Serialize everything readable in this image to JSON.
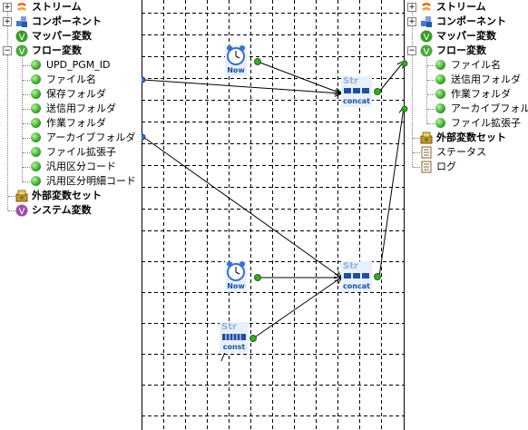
{
  "left_tree": {
    "items": [
      {
        "label": "ストリーム",
        "icon": "stream-icon",
        "bold": true
      },
      {
        "label": "コンポーネント",
        "icon": "component-icon",
        "bold": true
      },
      {
        "label": "マッパー変数",
        "icon": "mapper-variable-icon",
        "bold": true
      },
      {
        "label": "フロー変数",
        "icon": "flow-variable-icon",
        "bold": true
      },
      {
        "label": "UPD_PGM_ID",
        "icon": "variable-icon",
        "bold": false
      },
      {
        "label": "ファイル名",
        "icon": "variable-icon",
        "bold": false
      },
      {
        "label": "保存フォルダ",
        "icon": "variable-icon",
        "bold": false
      },
      {
        "label": "送信用フォルダ",
        "icon": "variable-icon",
        "bold": false
      },
      {
        "label": "作業フォルダ",
        "icon": "variable-icon",
        "bold": false
      },
      {
        "label": "アーカイブフォルダ",
        "icon": "variable-icon",
        "bold": false
      },
      {
        "label": "ファイル拡張子",
        "icon": "variable-icon",
        "bold": false
      },
      {
        "label": "汎用区分コード",
        "icon": "variable-icon",
        "bold": false
      },
      {
        "label": "汎用区分明細コード",
        "icon": "variable-icon",
        "bold": false
      },
      {
        "label": "外部変数セット",
        "icon": "external-variable-set-icon",
        "bold": true
      },
      {
        "label": "システム変数",
        "icon": "system-variable-icon",
        "bold": true
      }
    ]
  },
  "right_tree": {
    "items": [
      {
        "label": "ストリーム",
        "icon": "stream-icon",
        "bold": true
      },
      {
        "label": "コンポーネント",
        "icon": "component-icon",
        "bold": true
      },
      {
        "label": "マッパー変数",
        "icon": "mapper-variable-icon",
        "bold": true
      },
      {
        "label": "フロー変数",
        "icon": "flow-variable-icon",
        "bold": true
      },
      {
        "label": "ファイル名",
        "icon": "variable-icon",
        "bold": false
      },
      {
        "label": "送信用フォルダ",
        "icon": "variable-icon",
        "bold": false
      },
      {
        "label": "作業フォルダ",
        "icon": "variable-icon",
        "bold": false
      },
      {
        "label": "アーカイブフォルダ",
        "icon": "variable-icon",
        "bold": false
      },
      {
        "label": "ファイル拡張子",
        "icon": "variable-icon",
        "bold": false
      },
      {
        "label": "外部変数セット",
        "icon": "external-variable-set-icon",
        "bold": true
      },
      {
        "label": "ステータス",
        "icon": "document-icon",
        "bold": false
      },
      {
        "label": "ログ",
        "icon": "document-icon",
        "bold": false
      }
    ]
  },
  "canvas": {
    "functions": {
      "now1": {
        "caption": "Now",
        "icon": "clock-icon"
      },
      "concat1": {
        "header": "Str",
        "caption": "concat",
        "icon": "string-concat-icon"
      },
      "now2": {
        "caption": "Now",
        "icon": "clock-icon"
      },
      "concat2": {
        "header": "Str",
        "caption": "concat",
        "icon": "string-concat-icon"
      },
      "const1": {
        "header": "Str",
        "caption": "const",
        "icon": "string-const-icon"
      }
    }
  },
  "colors": {
    "grid": "#000000",
    "port": "#3aa72a",
    "link": "#000000",
    "func_caption": "#1f4fa0",
    "tree_line": "#808080"
  }
}
